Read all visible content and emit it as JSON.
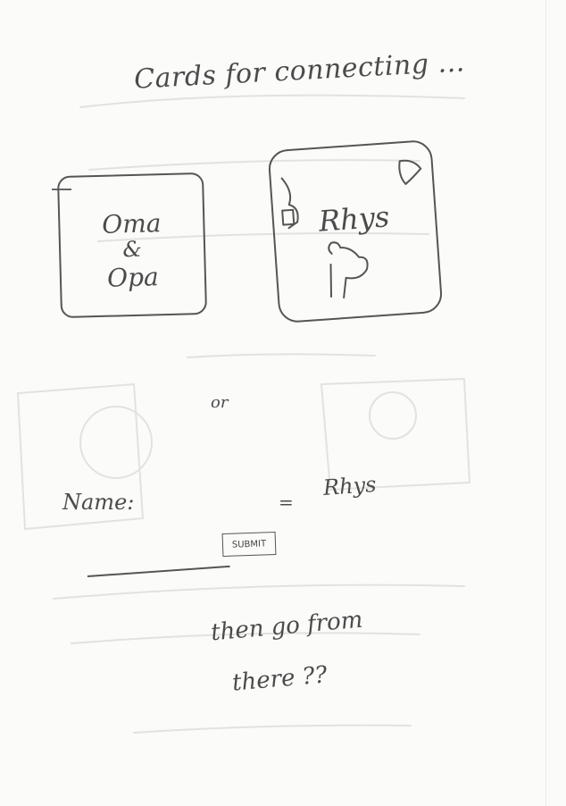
{
  "title": "Cards for connecting ...",
  "cards": [
    {
      "line1": "Oma",
      "line2": "&",
      "line3": "Opa"
    },
    {
      "label": "Rhys"
    }
  ],
  "or_text": "or",
  "name_label": "Name:",
  "equals": "=",
  "name_value": "Rhys",
  "submit_label": "SUBMIT",
  "footer_line1": "then go from",
  "footer_line2": "there ??"
}
